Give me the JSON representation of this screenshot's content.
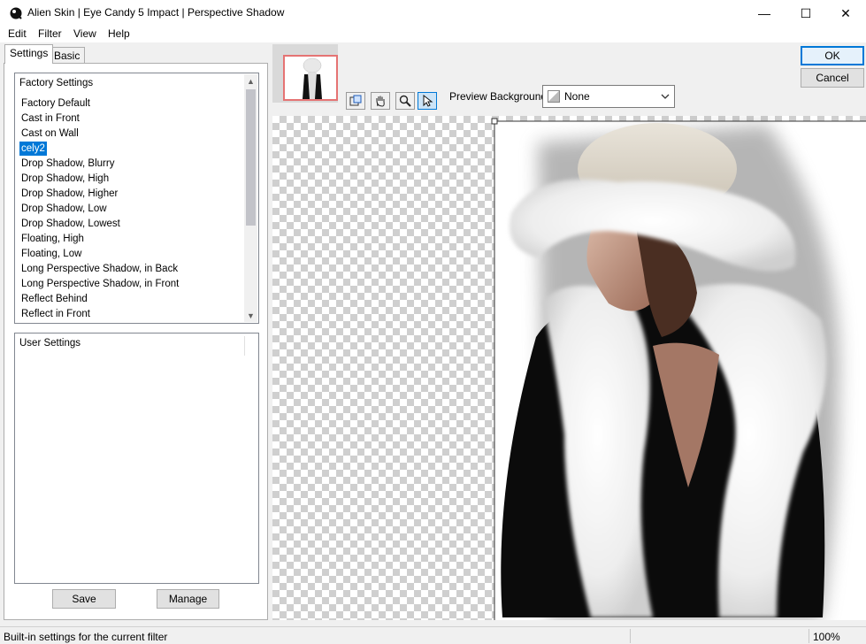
{
  "window": {
    "title": "Alien Skin | Eye Candy 5 Impact | Perspective Shadow",
    "minimize_glyph": "—",
    "maximize_glyph": "☐",
    "close_glyph": "✕"
  },
  "menu": [
    "Edit",
    "Filter",
    "View",
    "Help"
  ],
  "tabs": {
    "settings": "Settings",
    "basic": "Basic"
  },
  "factory": {
    "header": "Factory Settings",
    "items": [
      "Factory Default",
      "Cast in Front",
      "Cast on Wall",
      "cely2",
      "Drop Shadow, Blurry",
      "Drop Shadow, High",
      "Drop Shadow, Higher",
      "Drop Shadow, Low",
      "Drop Shadow, Lowest",
      "Floating, High",
      "Floating, Low",
      "Long Perspective Shadow, in Back",
      "Long Perspective Shadow, in Front",
      "Reflect Behind",
      "Reflect in Front"
    ],
    "selected": "cely2"
  },
  "user": {
    "header": "User Settings"
  },
  "buttons": {
    "save": "Save",
    "manage": "Manage",
    "ok": "OK",
    "cancel": "Cancel"
  },
  "preview_background": {
    "label": "Preview Background:",
    "value": "None"
  },
  "status": {
    "message": "Built-in settings for the current filter",
    "zoom": "100%"
  },
  "icons": [
    "app-logo-icon",
    "navigator-icon",
    "hand-icon",
    "zoom-icon",
    "pointer-icon",
    "chevron-down-icon"
  ]
}
